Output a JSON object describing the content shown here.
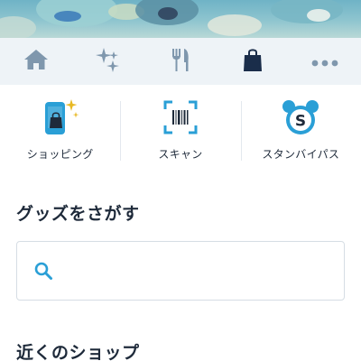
{
  "hero": {
    "image": "park-aerial-banner"
  },
  "nav": {
    "items": [
      {
        "icon": "home-icon",
        "active": false
      },
      {
        "icon": "sparkle-stars-icon",
        "active": false
      },
      {
        "icon": "fork-knife-icon",
        "active": false
      },
      {
        "icon": "shopping-bag-icon",
        "active": true
      },
      {
        "icon": "more-dots-icon",
        "active": false
      }
    ]
  },
  "actions": {
    "shopping": {
      "label": "ショッピング",
      "icon": "phone-shopping-bag-icon"
    },
    "scan": {
      "label": "スキャン",
      "icon": "barcode-scan-icon"
    },
    "standby": {
      "label": "スタンバイパス",
      "icon": "standby-pass-icon"
    }
  },
  "search_section": {
    "title": "グッズをさがす",
    "placeholder": ""
  },
  "nearby_section": {
    "title": "近くのショップ"
  },
  "colors": {
    "accent": "#2a9fd6",
    "dark": "#1e2a3a",
    "nav_icon": "#7f97ad",
    "nav_active": "#1a2d4a",
    "gold": "#e8b924"
  }
}
